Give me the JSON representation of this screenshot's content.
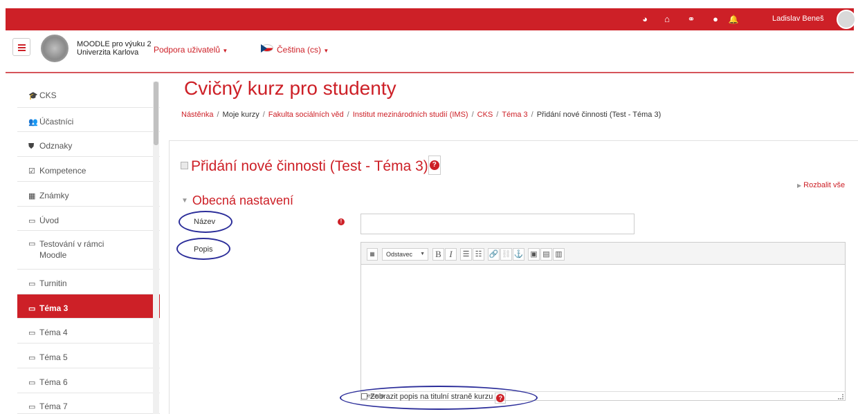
{
  "topbar": {
    "icons": [
      "dashboard-icon",
      "home-icon",
      "network-icon",
      "chat-icon",
      "bell-icon"
    ],
    "user_name": "Ladislav Beneš"
  },
  "header": {
    "site_name_line1": "MOODLE pro výuku 2",
    "site_name_line2": "Univerzita Karlova",
    "nav": {
      "support": "Podpora uživatelů",
      "language": "Čeština (cs)"
    }
  },
  "sidebar": {
    "items": [
      {
        "label": "CKS",
        "icon": "graduation-cap-icon"
      },
      {
        "label": "Účastníci",
        "icon": "users-icon"
      },
      {
        "label": "Odznaky",
        "icon": "shield-icon"
      },
      {
        "label": "Kompetence",
        "icon": "checkbox-icon"
      },
      {
        "label": "Známky",
        "icon": "table-icon"
      },
      {
        "label": "Úvod",
        "icon": "folder-icon"
      },
      {
        "label": "Testování v rámci Moodle",
        "icon": "folder-icon"
      },
      {
        "label": "Turnitin",
        "icon": "folder-icon"
      },
      {
        "label": "Téma 3",
        "icon": "folder-icon",
        "active": true
      },
      {
        "label": "Téma 4",
        "icon": "folder-icon"
      },
      {
        "label": "Téma 5",
        "icon": "folder-icon"
      },
      {
        "label": "Téma 6",
        "icon": "folder-icon"
      },
      {
        "label": "Téma 7",
        "icon": "folder-icon"
      }
    ]
  },
  "main": {
    "course_title": "Cvičný kurz pro studenty",
    "breadcrumb": [
      "Nástěnka",
      "Moje kurzy",
      "Fakulta sociálních věd",
      "Institut mezinárodních studií (IMS)",
      "CKS",
      "Téma 3",
      "Přidání nové činnosti (Test - Téma 3)"
    ],
    "activity_title": "Přidání nové činnosti (Test - Téma 3)",
    "expand_all": "Rozbalit vše",
    "section_title": "Obecná nastavení",
    "name_label": "Název",
    "name_value": "",
    "description_label": "Popis",
    "editor": {
      "paragraph_select": "Odstavec",
      "path_label": "Cesta: p"
    },
    "show_description_label": "Zobrazit popis na titulní straně kurzu"
  },
  "colors": {
    "brand_red": "#cd2027",
    "highlight_circle": "#2c2e9a"
  }
}
